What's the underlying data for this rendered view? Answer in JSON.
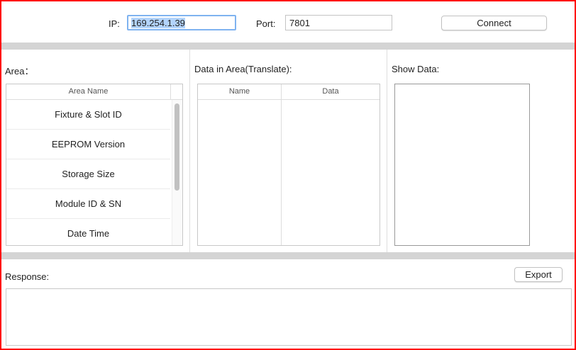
{
  "connection": {
    "ip_label": "IP:",
    "ip_value": "169.254.1.39",
    "port_label": "Port:",
    "port_value": "7801",
    "connect_label": "Connect"
  },
  "area": {
    "label": "Area：",
    "column": "Area Name",
    "items": [
      "Fixture & Slot ID",
      "EEPROM Version",
      "Storage Size",
      "Module ID & SN",
      "Date Time"
    ]
  },
  "data_area": {
    "label": "Data in Area(Translate):",
    "columns": [
      "Name",
      "Data"
    ]
  },
  "show_data": {
    "label": "Show Data:"
  },
  "response": {
    "label": "Response:",
    "export_label": "Export",
    "value": ""
  }
}
